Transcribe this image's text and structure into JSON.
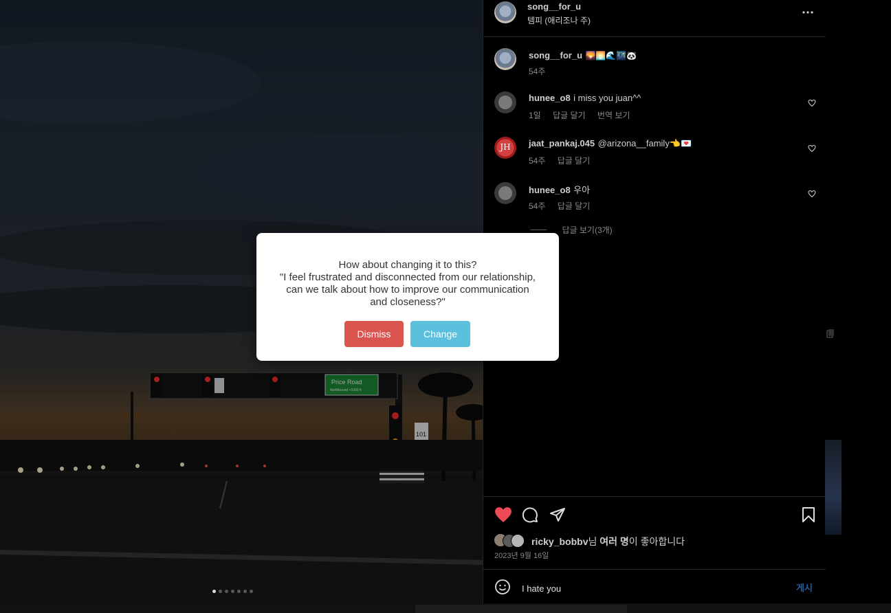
{
  "post": {
    "author": "song__for_u",
    "location": "템피 (애리조나 주)",
    "caption_author": "song__for_u",
    "caption_emojis": "🌄🌅🌊🌃🐼",
    "caption_time": "54주",
    "photo_sign_text": "Price Road",
    "photo_sign_subtext": "Northbound +1000 ft",
    "photo_route_number": "101",
    "carousel_dots": 7,
    "carousel_active": 0
  },
  "comments": [
    {
      "user": "hunee_o8",
      "text": "i miss you juan^^",
      "time": "1일",
      "reply": "답글 달기",
      "translate": "번역 보기",
      "avatar": "grey"
    },
    {
      "user": "jaat_pankaj.045",
      "text": "@arizona__family👈💌",
      "time": "54주",
      "reply": "답글 달기",
      "translate": "",
      "avatar": "red",
      "avatar_letter": "JH"
    },
    {
      "user": "hunee_o8",
      "text": "우아",
      "time": "54주",
      "reply": "답글 달기",
      "translate": "",
      "avatar": "grey"
    }
  ],
  "view_replies": "답글 보기(3개)",
  "likes": {
    "user": "ricky_bobbv",
    "suffix_before": "님 ",
    "others": "여러 명",
    "suffix_after": "이 좋아합니다",
    "date": "2023년 9월 16일"
  },
  "composer": {
    "value": "I hate you",
    "post_label": "게시"
  },
  "modal": {
    "line1": "How about changing it to this?",
    "quote": "\"I feel frustrated and disconnected from our relationship, can we talk about how to improve our communication and closeness?\"",
    "dismiss_label": "Dismiss",
    "change_label": "Change"
  },
  "colors": {
    "heart": "#ed4956",
    "dismiss": "#d9534f",
    "change": "#5bc0de",
    "post_button": "#1f5ea8"
  },
  "icons": {
    "more": "more-horizontal-icon",
    "like": "heart-filled-icon",
    "comment": "comment-icon",
    "share": "send-icon",
    "save": "bookmark-icon",
    "emoji": "emoji-icon"
  }
}
